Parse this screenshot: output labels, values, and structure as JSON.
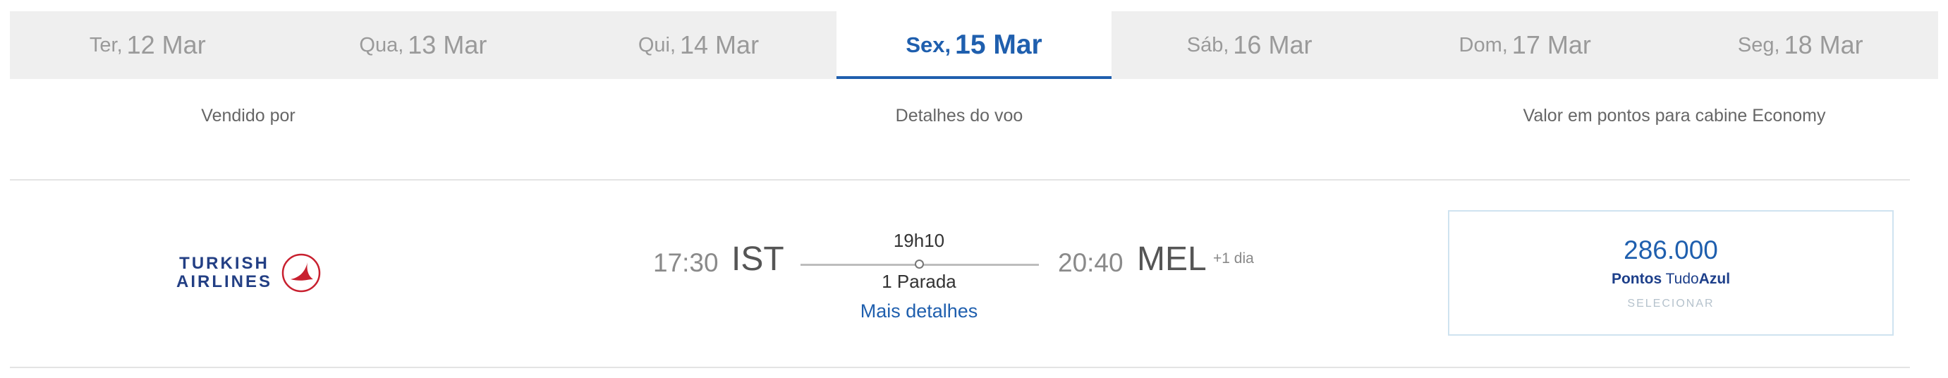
{
  "date_tabs": [
    {
      "dow": "Ter,",
      "day": "12 Mar",
      "active": false
    },
    {
      "dow": "Qua,",
      "day": "13 Mar",
      "active": false
    },
    {
      "dow": "Qui,",
      "day": "14 Mar",
      "active": false
    },
    {
      "dow": "Sex,",
      "day": "15 Mar",
      "active": true
    },
    {
      "dow": "Sáb,",
      "day": "16 Mar",
      "active": false
    },
    {
      "dow": "Dom,",
      "day": "17 Mar",
      "active": false
    },
    {
      "dow": "Seg,",
      "day": "18 Mar",
      "active": false
    }
  ],
  "headers": {
    "sold_by": "Vendido por",
    "flight_details": "Detalhes do voo",
    "points_value": "Valor em pontos para cabine Economy"
  },
  "flight": {
    "airline": {
      "line1": "TURKISH",
      "line2": "AIRLINES",
      "icon": "turkish-airlines-bird-logo"
    },
    "departure_time": "17:30",
    "departure_airport": "IST",
    "duration": "19h10",
    "stops": "1 Parada",
    "arrival_time": "20:40",
    "arrival_airport": "MEL",
    "next_day": "+1 dia",
    "more_details": "Mais detalhes"
  },
  "points": {
    "value": "286.000",
    "label_bold": "Pontos",
    "label_tudo": "Tudo",
    "label_azul": "Azul",
    "select": "SELECIONAR"
  },
  "colors": {
    "accent": "#1f5fae",
    "tab_bar_bg": "#efefef",
    "airline_blue": "#233f84",
    "airline_red": "#c8202f",
    "points_border": "#cfe3f0"
  }
}
